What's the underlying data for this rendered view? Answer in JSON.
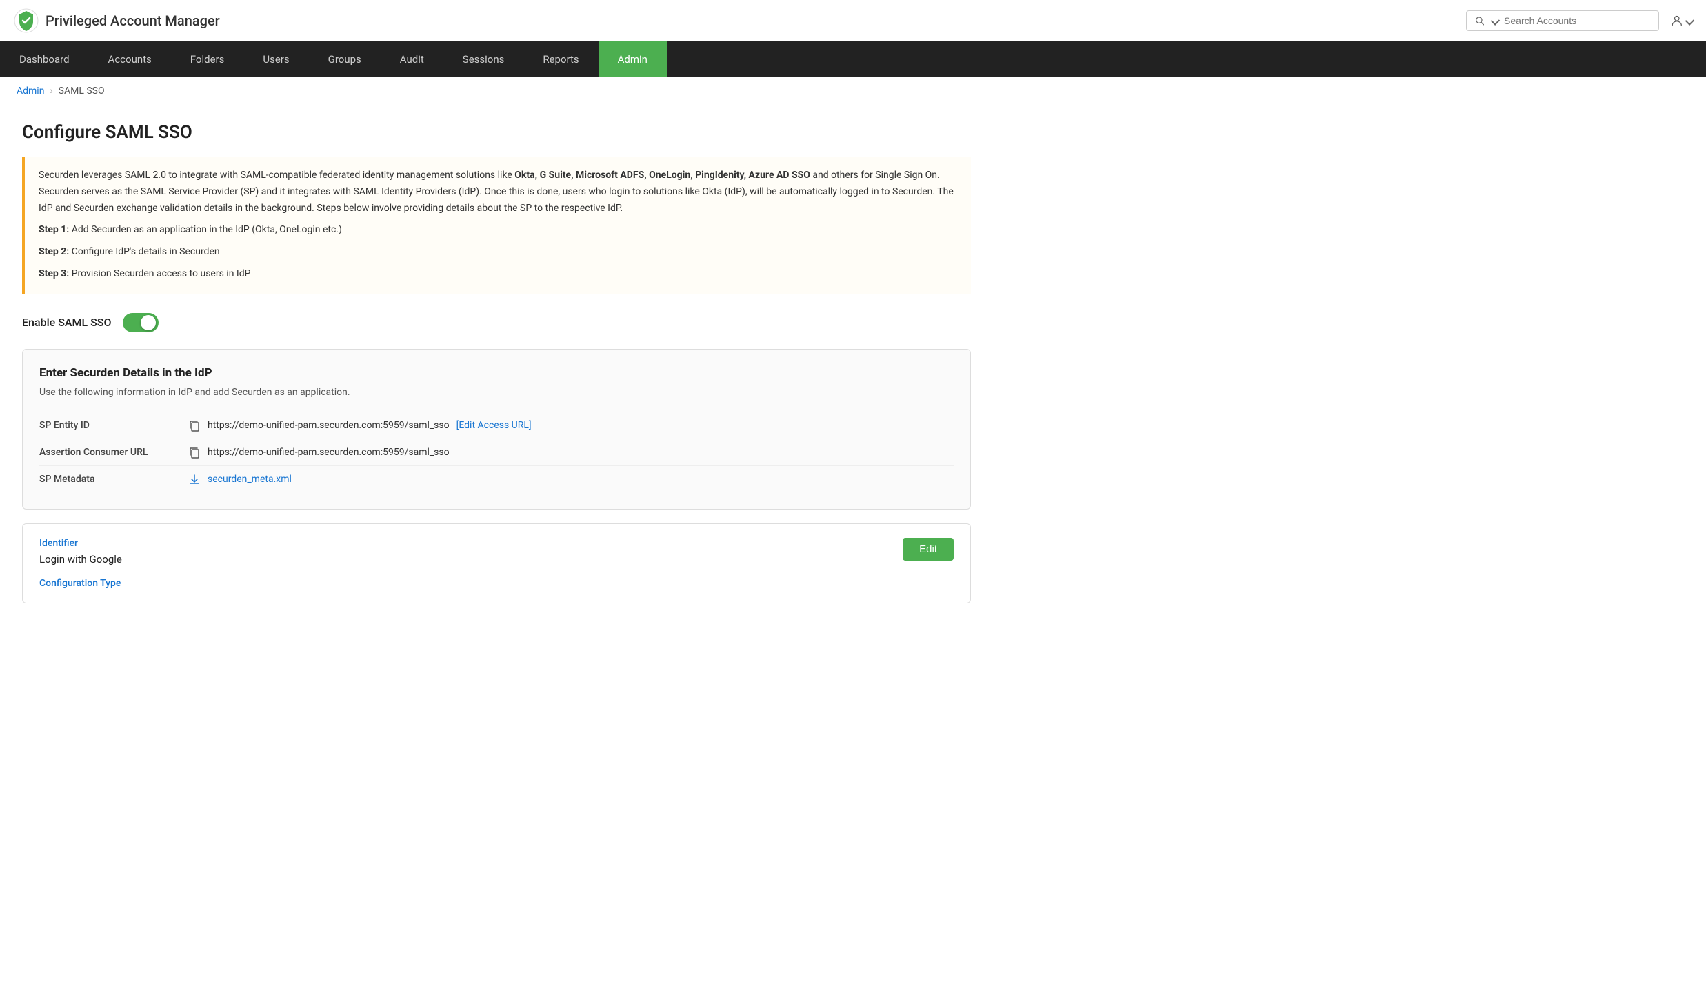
{
  "app": {
    "title": "Privileged Account Manager"
  },
  "header": {
    "search_placeholder": "Search Accounts"
  },
  "nav": {
    "items": [
      {
        "label": "Dashboard",
        "active": false
      },
      {
        "label": "Accounts",
        "active": false
      },
      {
        "label": "Folders",
        "active": false
      },
      {
        "label": "Users",
        "active": false
      },
      {
        "label": "Groups",
        "active": false
      },
      {
        "label": "Audit",
        "active": false
      },
      {
        "label": "Sessions",
        "active": false
      },
      {
        "label": "Reports",
        "active": false
      },
      {
        "label": "Admin",
        "active": true
      }
    ]
  },
  "breadcrumb": {
    "parent_label": "Admin",
    "current_label": "SAML SSO"
  },
  "page": {
    "title": "Configure SAML SSO"
  },
  "info_box": {
    "intro": "Securden leverages SAML 2.0 to integrate with SAML-compatible federated identity management solutions like ",
    "bold_providers": "Okta, G Suite, Microsoft ADFS, OneLogin, PingIdenity, Azure AD SSO",
    "outro": " and others for Single Sign On. Securden serves as the SAML Service Provider (SP) and it integrates with SAML Identity Providers (IdP). Once this is done, users who login to solutions like Okta (IdP), will be automatically logged in to Securden. The IdP and Securden exchange validation details in the background. Steps below involve providing details about the SP to the respective IdP.",
    "step1_label": "Step 1:",
    "step1_text": " Add Securden as an application in the IdP (Okta, OneLogin etc.)",
    "step2_label": "Step 2:",
    "step2_text": " Configure IdP's details in Securden",
    "step3_label": "Step 3:",
    "step3_text": " Provision Securden access to users in IdP"
  },
  "toggle": {
    "label": "Enable SAML SSO",
    "enabled": true
  },
  "sp_details": {
    "section_title": "Enter Securden Details in the IdP",
    "section_subtitle": "Use the following information in IdP and add Securden as an application.",
    "fields": [
      {
        "label": "SP Entity ID",
        "value": "https://demo-unified-pam.securden.com:5959/saml_sso",
        "link_label": "[Edit Access URL]",
        "has_link": true,
        "has_download": false
      },
      {
        "label": "Assertion Consumer URL",
        "value": "https://demo-unified-pam.securden.com:5959/saml_sso",
        "has_link": false,
        "has_download": false
      },
      {
        "label": "SP Metadata",
        "value": "securden_meta.xml",
        "has_link": false,
        "has_download": true
      }
    ]
  },
  "identifier_card": {
    "identifier_label": "Identifier",
    "identifier_value": "Login with Google",
    "config_type_label": "Configuration Type",
    "edit_button_label": "Edit"
  }
}
